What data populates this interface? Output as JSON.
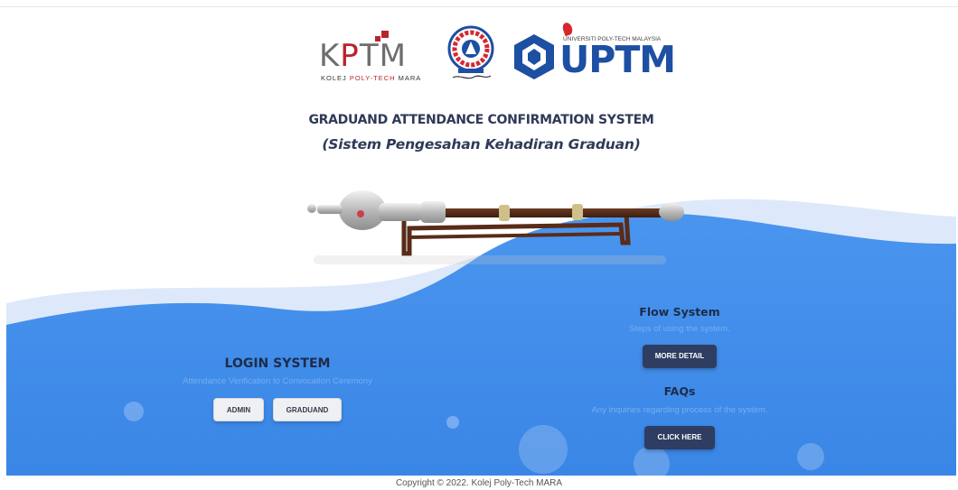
{
  "logos": {
    "kptm": {
      "letters_left": "K",
      "letters_red": "P",
      "letters_right": "TM",
      "sub_left": "KOLEJ ",
      "sub_red": "POLY-TECH",
      "sub_right": " MARA"
    },
    "uptm": {
      "name": "UPTM",
      "sub": "UNIVERSITI POLY-TECH MALAYSIA"
    }
  },
  "header": {
    "title": "GRADUAND ATTENDANCE CONFIRMATION SYSTEM",
    "subtitle": "(Sistem Pengesahan Kehadiran Graduan)"
  },
  "login": {
    "title": "LOGIN SYSTEM",
    "description": "Attendance Verification to Convocation Ceremony",
    "admin_label": "ADMIN",
    "graduand_label": "GRADUAND"
  },
  "flow": {
    "title": "Flow System",
    "description": "Steps of using the system.",
    "button_label": "MORE DETAIL"
  },
  "faq": {
    "title": "FAQs",
    "description": "Any inquiries regarding process of the system.",
    "button_label": "CLICK HERE"
  },
  "footer": {
    "copyright": "Copyright © 2022. Kolej Poly-Tech MARA"
  },
  "colors": {
    "wave_blue": "#3d8ae8",
    "wave_light": "#dce9fb",
    "title_navy": "#2f3a57",
    "button_dark": "#2e3d61",
    "kptm_red": "#b8242c",
    "uptm_blue": "#1d4fa3"
  }
}
